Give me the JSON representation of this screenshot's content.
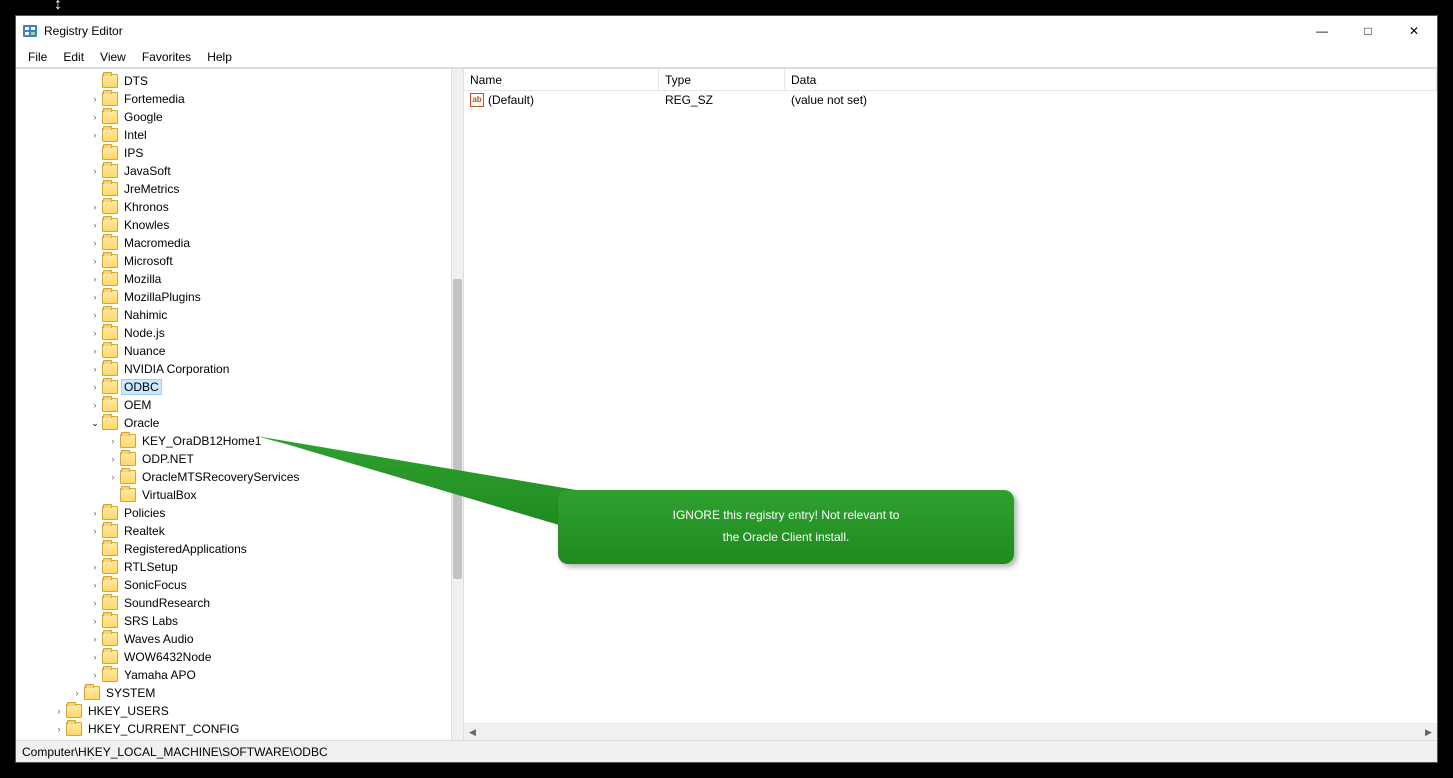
{
  "window": {
    "title": "Registry Editor"
  },
  "menus": [
    "File",
    "Edit",
    "View",
    "Favorites",
    "Help"
  ],
  "winbuttons": {
    "min": "—",
    "max": "□",
    "close": "✕"
  },
  "tree": [
    {
      "label": "DTS",
      "depth": 4,
      "twist": ""
    },
    {
      "label": "Fortemedia",
      "depth": 4,
      "twist": "›"
    },
    {
      "label": "Google",
      "depth": 4,
      "twist": "›"
    },
    {
      "label": "Intel",
      "depth": 4,
      "twist": "›"
    },
    {
      "label": "IPS",
      "depth": 4,
      "twist": ""
    },
    {
      "label": "JavaSoft",
      "depth": 4,
      "twist": "›"
    },
    {
      "label": "JreMetrics",
      "depth": 4,
      "twist": ""
    },
    {
      "label": "Khronos",
      "depth": 4,
      "twist": "›"
    },
    {
      "label": "Knowles",
      "depth": 4,
      "twist": "›"
    },
    {
      "label": "Macromedia",
      "depth": 4,
      "twist": "›"
    },
    {
      "label": "Microsoft",
      "depth": 4,
      "twist": "›"
    },
    {
      "label": "Mozilla",
      "depth": 4,
      "twist": "›"
    },
    {
      "label": "MozillaPlugins",
      "depth": 4,
      "twist": "›"
    },
    {
      "label": "Nahimic",
      "depth": 4,
      "twist": "›"
    },
    {
      "label": "Node.js",
      "depth": 4,
      "twist": "›"
    },
    {
      "label": "Nuance",
      "depth": 4,
      "twist": "›"
    },
    {
      "label": "NVIDIA Corporation",
      "depth": 4,
      "twist": "›"
    },
    {
      "label": "ODBC",
      "depth": 4,
      "twist": "›",
      "selected": true
    },
    {
      "label": "OEM",
      "depth": 4,
      "twist": "›"
    },
    {
      "label": "Oracle",
      "depth": 4,
      "twist": "⌄",
      "expanded": true
    },
    {
      "label": "KEY_OraDB12Home1",
      "depth": 5,
      "twist": "›"
    },
    {
      "label": "ODP.NET",
      "depth": 5,
      "twist": "›"
    },
    {
      "label": "OracleMTSRecoveryServices",
      "depth": 5,
      "twist": "›"
    },
    {
      "label": "VirtualBox",
      "depth": 5,
      "twist": ""
    },
    {
      "label": "Policies",
      "depth": 4,
      "twist": "›"
    },
    {
      "label": "Realtek",
      "depth": 4,
      "twist": "›"
    },
    {
      "label": "RegisteredApplications",
      "depth": 4,
      "twist": ""
    },
    {
      "label": "RTLSetup",
      "depth": 4,
      "twist": "›"
    },
    {
      "label": "SonicFocus",
      "depth": 4,
      "twist": "›"
    },
    {
      "label": "SoundResearch",
      "depth": 4,
      "twist": "›"
    },
    {
      "label": "SRS Labs",
      "depth": 4,
      "twist": "›"
    },
    {
      "label": "Waves Audio",
      "depth": 4,
      "twist": "›"
    },
    {
      "label": "WOW6432Node",
      "depth": 4,
      "twist": "›"
    },
    {
      "label": "Yamaha APO",
      "depth": 4,
      "twist": "›"
    },
    {
      "label": "SYSTEM",
      "depth": 3,
      "twist": "›"
    },
    {
      "label": "HKEY_USERS",
      "depth": 2,
      "twist": "›"
    },
    {
      "label": "HKEY_CURRENT_CONFIG",
      "depth": 2,
      "twist": "›"
    }
  ],
  "columns": {
    "name": "Name",
    "type": "Type",
    "data": "Data"
  },
  "rows": [
    {
      "name": "(Default)",
      "type": "REG_SZ",
      "data": "(value not set)",
      "icon": "ab"
    }
  ],
  "statusbar": "Computer\\HKEY_LOCAL_MACHINE\\SOFTWARE\\ODBC",
  "callout": {
    "line1": "IGNORE this registry entry!  Not relevant to",
    "line2": "the Oracle Client install."
  }
}
